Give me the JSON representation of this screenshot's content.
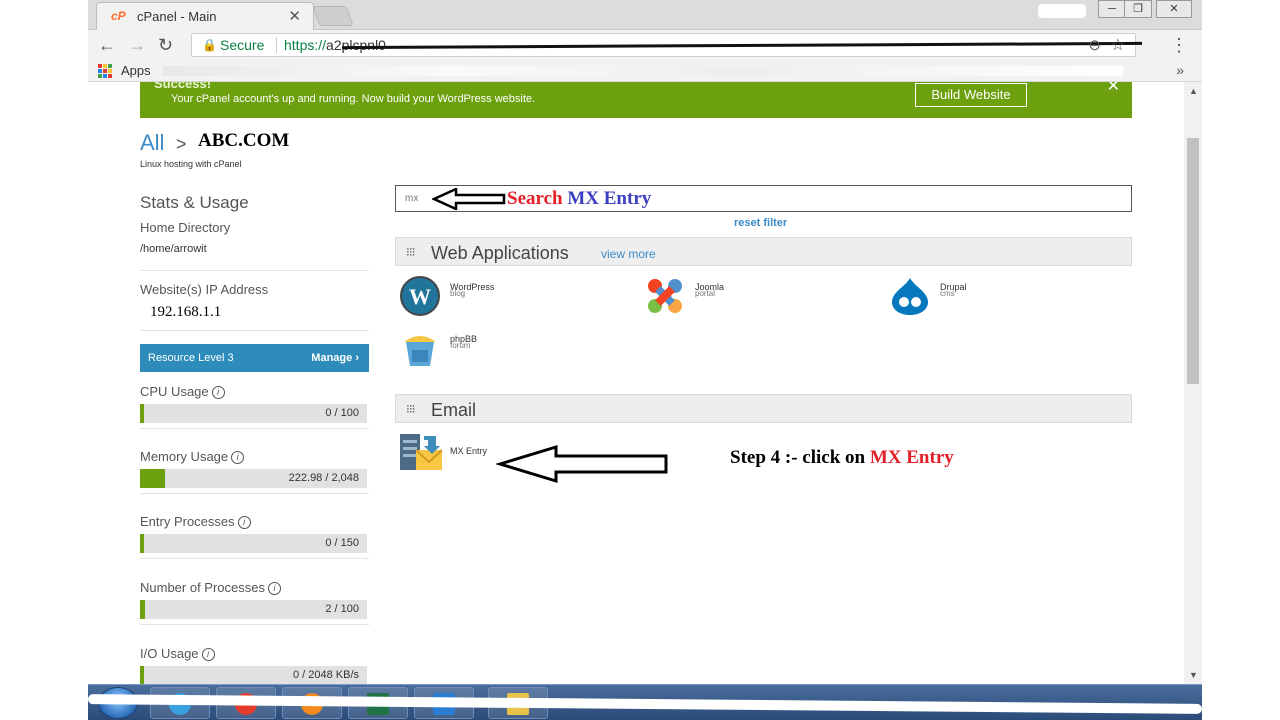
{
  "browser": {
    "tab_title": "cPanel - Main",
    "tab_close": "✕",
    "favicon_text": "cP",
    "secure_label": "Secure",
    "url_prefix": "https://",
    "url_visible": "a2plcpnl0",
    "bookmarks_apps_label": "Apps",
    "bookmarks_more": "»",
    "nav_back": "←",
    "nav_forward": "→",
    "nav_reload": "↻",
    "zoom_icon": "⊖",
    "star_icon": "☆",
    "menu_icon": "⋮",
    "window_min": "─",
    "window_max": "❐",
    "window_close": "✕"
  },
  "banner": {
    "title": "Success!",
    "message": "Your cPanel account's up and running. Now build your WordPress website.",
    "button_label": "Build Website",
    "close": "✕"
  },
  "breadcrumb": {
    "all": "All",
    "separator": ">",
    "domain": "ABC.COM",
    "subtitle": "Linux hosting with cPanel"
  },
  "sidebar": {
    "heading": "Stats & Usage",
    "home_dir_label": "Home Directory",
    "home_dir_value": "/home/arrowit",
    "ip_label": "Website(s) IP Address",
    "ip_value": "192.168.1.1",
    "resource_level": "Resource Level 3",
    "manage_label": "Manage",
    "manage_icon": "›",
    "usage": [
      {
        "label": "CPU Usage",
        "value": "0 / 100",
        "fill_fraction": 0.0
      },
      {
        "label": "Memory Usage",
        "value": "222.98 / 2,048",
        "fill_fraction": 0.109
      },
      {
        "label": "Entry Processes",
        "value": "0 / 150",
        "fill_fraction": 0.0
      },
      {
        "label": "Number of Processes",
        "value": "2 / 100",
        "fill_fraction": 0.02
      },
      {
        "label": "I/O Usage",
        "value": "0 / 2048 KB/s",
        "fill_fraction": 0.0
      }
    ],
    "info_icon": "i"
  },
  "search": {
    "value": "mx",
    "annotation_red": "Search ",
    "annotation_blue": "MX Entry",
    "reset_filter": "reset filter"
  },
  "sections": {
    "web_apps": {
      "title": "Web Applications",
      "view_more": "view more",
      "apps": [
        {
          "name": "WordPress",
          "sub": "blog",
          "icon": "wordpress-icon"
        },
        {
          "name": "Joomla",
          "sub": "portal",
          "icon": "joomla-icon"
        },
        {
          "name": "Drupal",
          "sub": "cms",
          "icon": "drupal-icon"
        },
        {
          "name": "phpBB",
          "sub": "forum",
          "icon": "phpbb-icon"
        }
      ]
    },
    "email": {
      "title": "Email",
      "items": [
        {
          "name": "MX Entry",
          "icon": "mx-entry-icon"
        }
      ]
    }
  },
  "annotation": {
    "step_prefix": "Step 4 :- click on ",
    "step_highlight": "MX Entry"
  },
  "colors": {
    "banner_green": "#6da00f",
    "accent_blue": "#3a8bc8",
    "resource_blue": "#2d8cba",
    "annotation_red": "#e41e26",
    "annotation_blue": "#3b3fbf"
  }
}
